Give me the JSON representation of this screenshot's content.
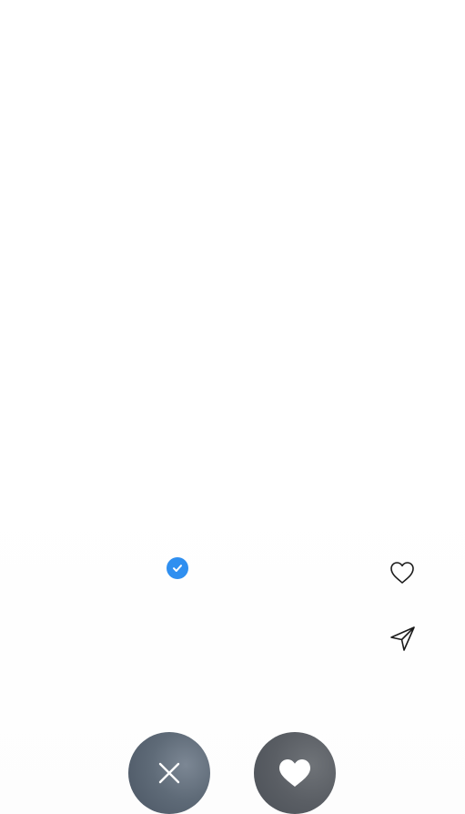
{
  "profile": {
    "name": "",
    "verified": true
  },
  "actions": {
    "like_icon": "heart-outline-icon",
    "send_icon": "paper-plane-icon",
    "dismiss_icon": "close-icon",
    "super_like_icon": "heart-filled-icon"
  },
  "colors": {
    "verified_badge": "#2f8ff0",
    "fab_background": "#5f6b78",
    "icon_stroke": "#1a1a1a"
  }
}
